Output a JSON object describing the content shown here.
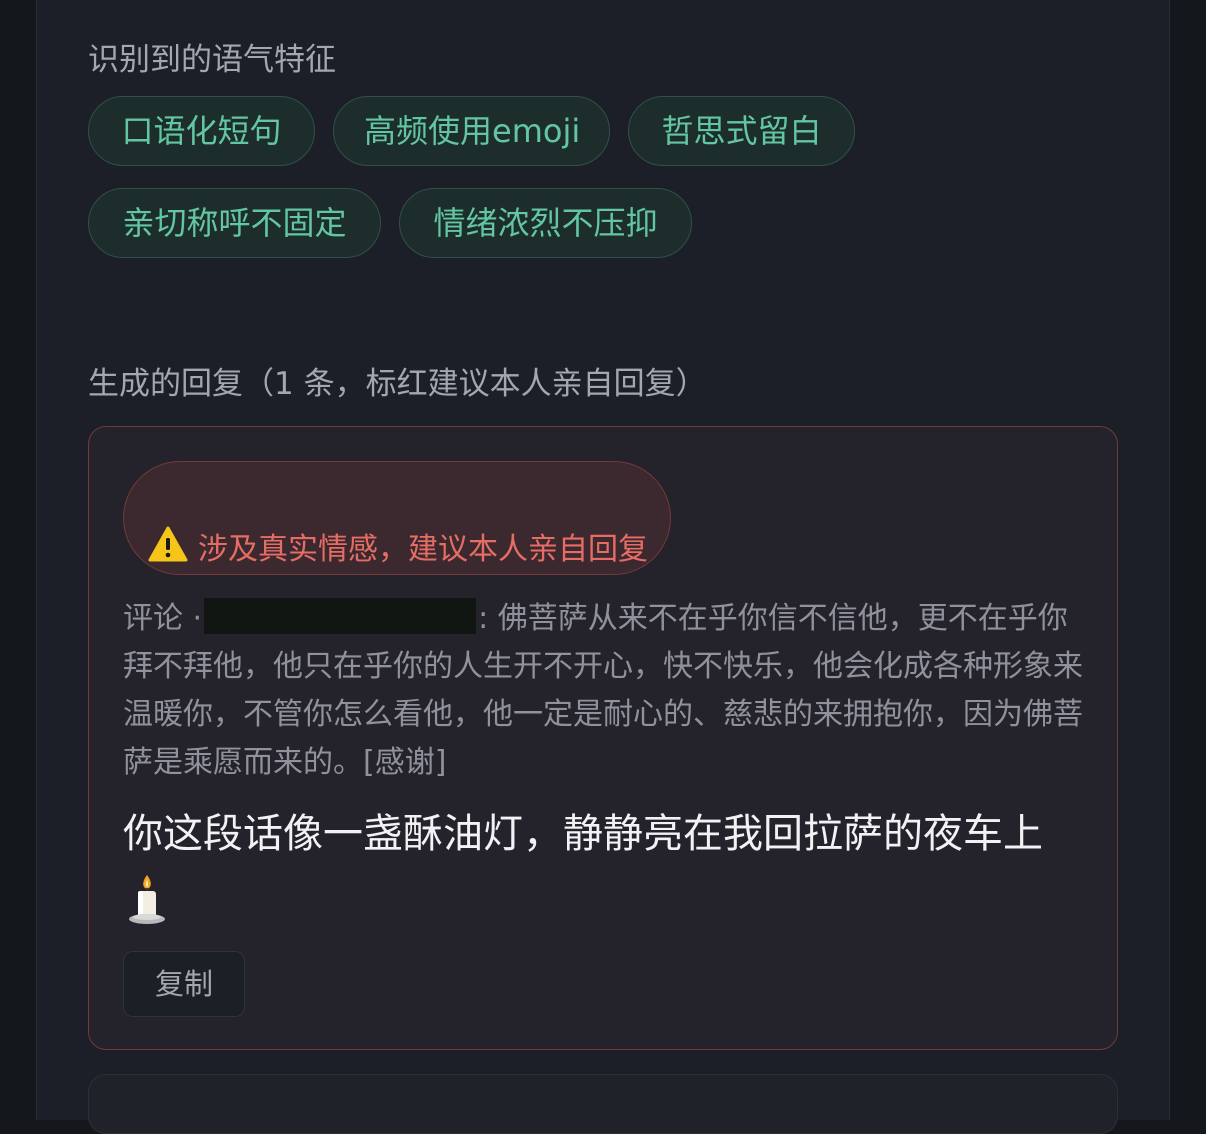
{
  "tone_section": {
    "title": "识别到的语气特征",
    "tags": [
      "口语化短句",
      "高频使用emoji",
      "哲思式留白",
      "亲切称呼不固定",
      "情绪浓烈不压抑"
    ]
  },
  "replies_section": {
    "title": "生成的回复（1 条，标红建议本人亲自回复）"
  },
  "reply_card": {
    "warning_icon": "warning-icon",
    "warning_text": "涉及真实情感，建议本人亲自回复",
    "comment_prefix": "评论 ·",
    "comment_body": ": 佛菩萨从来不在乎你信不信他，更不在乎你拜不拜他，他只在乎你的人生开不开心，快不快乐，他会化成各种形象来温暖你，不管你怎么看他，他一定是耐心的、慈悲的来拥抱你，因为佛菩萨是乘愿而来的。[感谢]",
    "reply_text": "你这段话像一盏酥油灯，静静亮在我回拉萨的夜车上",
    "reply_emoji": "candle-icon",
    "copy_label": "复制"
  },
  "colors": {
    "page_bg": "#14171c",
    "panel_bg": "#1c1f27",
    "tag_text": "#62c6a2",
    "warning_red": "#e56d63",
    "card_border": "#74393a"
  }
}
